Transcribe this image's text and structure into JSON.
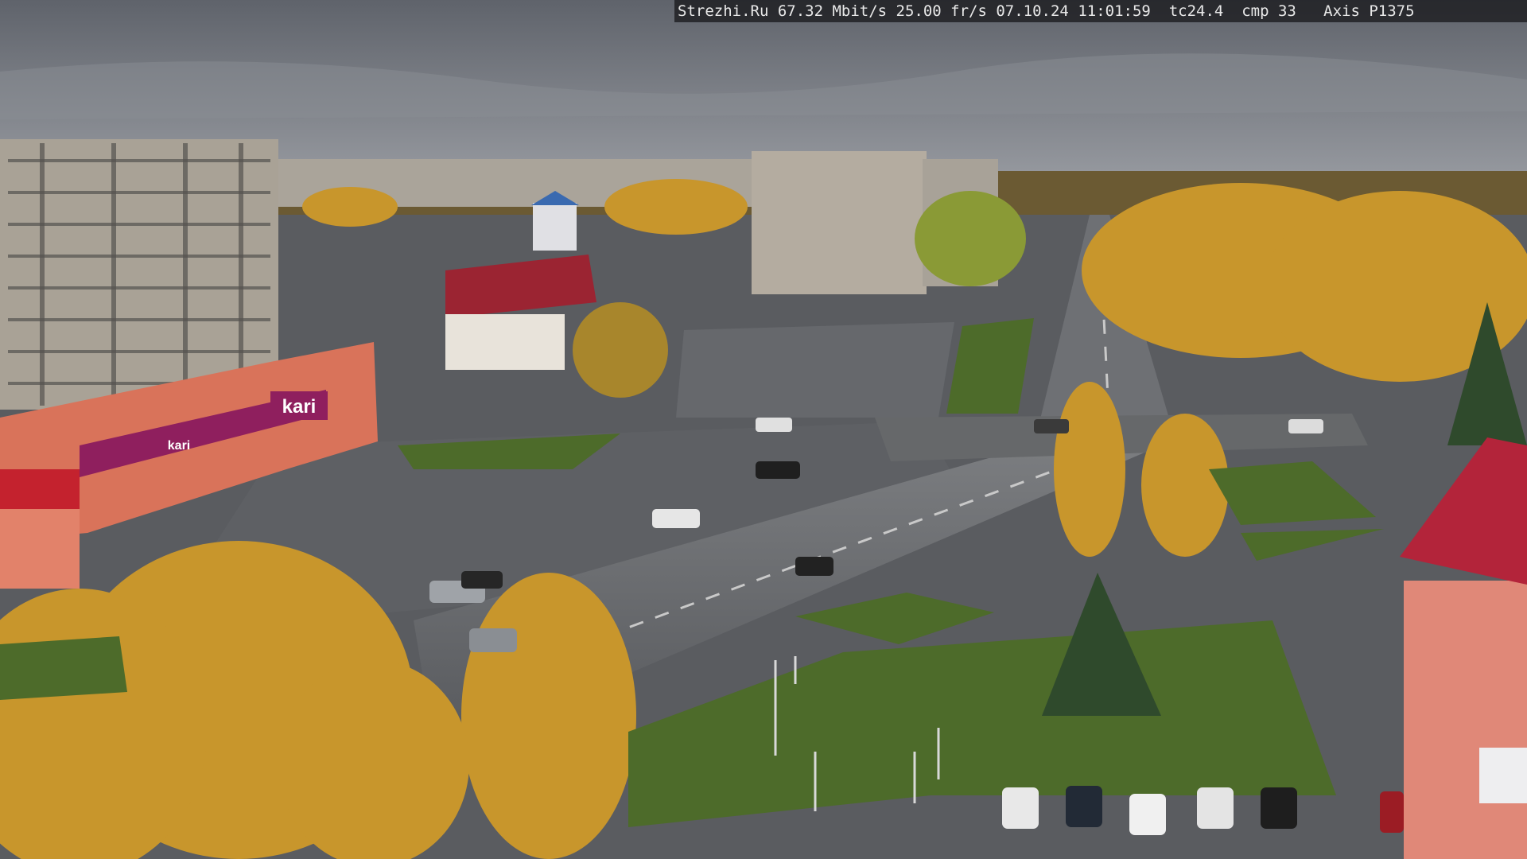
{
  "overlay": {
    "text": "Strezhi.Ru 67.32 Mbit/s 25.00 fr/s 07.10.24 11:01:59  tc24.4  cmp 33   Axis P1375"
  },
  "signs": {
    "store_main": "kari",
    "store_small": "kari"
  },
  "colors": {
    "sky": "#7d8088",
    "asphalt": "#5c5e62",
    "grass": "#4d6b2a",
    "autumn": "#c8962c",
    "store_magenta": "#8f1f5e",
    "roof_red": "#b3243a"
  }
}
